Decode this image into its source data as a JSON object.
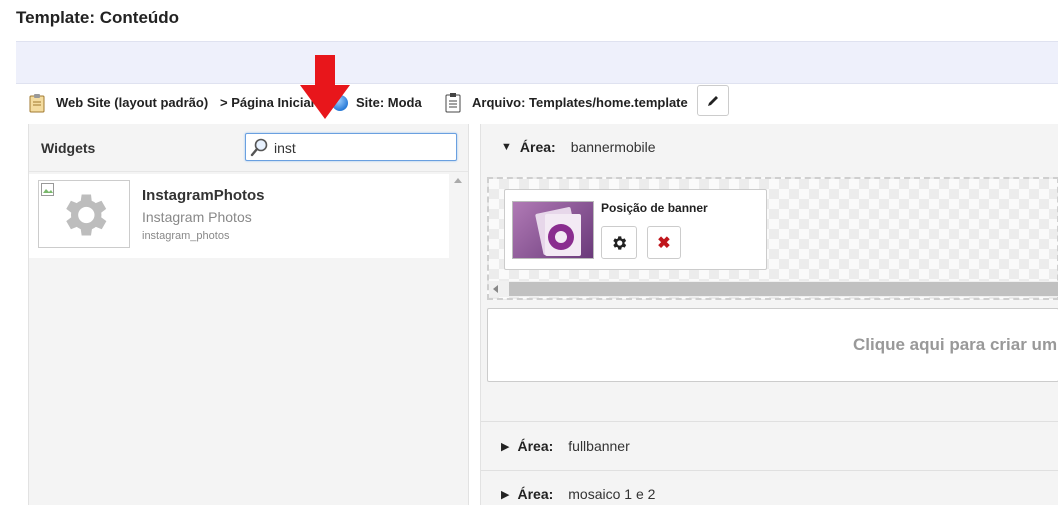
{
  "page": {
    "title": "Template: Conteúdo"
  },
  "breadcrumbs": {
    "website": "Web Site (layout padrão)",
    "page": "> Página Inicial",
    "site": "Site: Moda",
    "file": "Arquivo: Templates/home.template"
  },
  "widgets": {
    "label": "Widgets",
    "search_value": "inst",
    "items": [
      {
        "name": "InstagramPhotos",
        "description": "Instagram Photos",
        "code": "instagram_photos"
      }
    ]
  },
  "areas": [
    {
      "label": "Área:",
      "value": "bannermobile",
      "expanded": true
    },
    {
      "label": "Área:",
      "value": "fullbanner",
      "expanded": false
    },
    {
      "label": "Área:",
      "value": "mosaico 1 e 2",
      "expanded": false
    }
  ],
  "banner": {
    "title": "Posição de banner"
  },
  "create_area_text": "Clique aqui para criar um",
  "colors": {
    "accent_red": "#e8161b",
    "delete_red": "#c0161c",
    "info_bar": "#eef0fb"
  }
}
